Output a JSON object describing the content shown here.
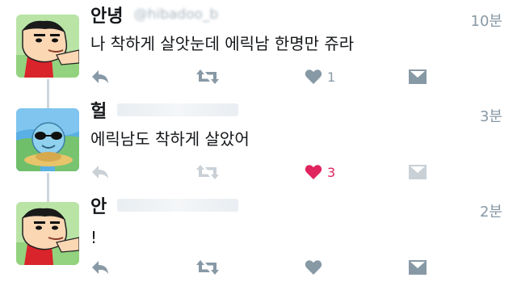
{
  "colors": {
    "icon": "#8899a6",
    "icon_muted": "#ccd6dd",
    "like_active": "#e0245e",
    "thread_line": "#ccd6dd",
    "text": "#14171a",
    "meta": "#8899a6"
  },
  "tweets": [
    {
      "name": "안녕",
      "handle": "@hibadoo_b",
      "time": "10분",
      "text": "나 착하게 살앗눈데 에릭남 한명만 쥬라",
      "likes": "1",
      "liked": false,
      "avatar_icon": "crayon-boy-avatar"
    },
    {
      "name": "헐",
      "handle": "",
      "time": "3분",
      "text": "에릭남도 착하게 살았어",
      "likes": "3",
      "liked": true,
      "avatar_icon": "cartoon-squirtle-avatar"
    },
    {
      "name": "안",
      "handle": "",
      "time": "2분",
      "text": "!",
      "likes": "",
      "liked": false,
      "avatar_icon": "crayon-boy-avatar"
    }
  ],
  "icons": {
    "reply": "reply-icon",
    "retweet": "retweet-icon",
    "like": "heart-icon",
    "dm": "envelope-icon"
  }
}
